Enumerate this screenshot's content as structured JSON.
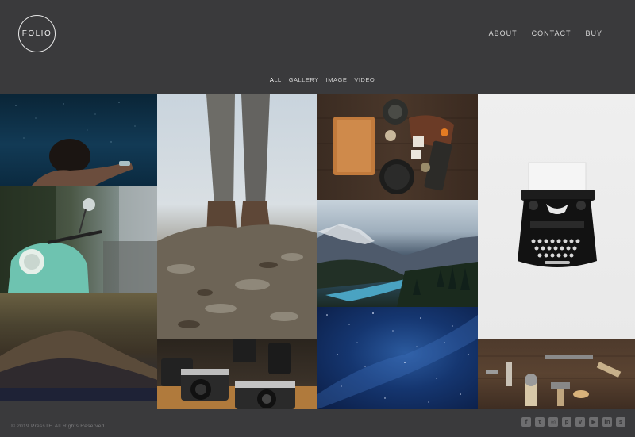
{
  "brand": {
    "logo_text": "FOLIO"
  },
  "nav": {
    "items": [
      "ABOUT",
      "CONTACT",
      "BUY"
    ]
  },
  "filters": {
    "items": [
      "ALL",
      "GALLERY",
      "IMAGE",
      "VIDEO"
    ],
    "active": "ALL"
  },
  "gallery": {
    "tiles": [
      {
        "name": "underwater-swimmer-photo"
      },
      {
        "name": "mint-scooter-photo"
      },
      {
        "name": "foggy-mountain-photo"
      },
      {
        "name": "hiking-boots-rocks-photo"
      },
      {
        "name": "vintage-cameras-photo"
      },
      {
        "name": "desk-flatlay-photo"
      },
      {
        "name": "mountain-lake-photo"
      },
      {
        "name": "starry-sky-photo"
      },
      {
        "name": "typewriter-photo"
      },
      {
        "name": "vintage-tools-photo"
      }
    ]
  },
  "footer": {
    "copyright": "© 2019 PressTF. All Rights Reserved",
    "social": [
      {
        "icon": "facebook-icon",
        "glyph": "f"
      },
      {
        "icon": "twitter-icon",
        "glyph": "t"
      },
      {
        "icon": "instagram-icon",
        "glyph": "◎"
      },
      {
        "icon": "pinterest-icon",
        "glyph": "p"
      },
      {
        "icon": "vimeo-icon",
        "glyph": "v"
      },
      {
        "icon": "youtube-icon",
        "glyph": "▶"
      },
      {
        "icon": "linkedin-icon",
        "glyph": "in"
      },
      {
        "icon": "soundcloud-icon",
        "glyph": "s"
      }
    ]
  }
}
